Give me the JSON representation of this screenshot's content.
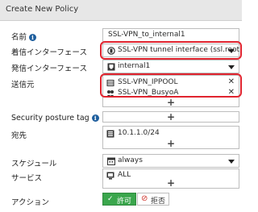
{
  "dialog": {
    "title": "Create New Policy"
  },
  "form": {
    "name": {
      "label": "名前",
      "value": "SSL-VPN_to_internal1"
    },
    "incoming_interface": {
      "label": "着信インターフェース",
      "value": "SSL-VPN tunnel interface (ssl.root)"
    },
    "outgoing_interface": {
      "label": "発信インターフェース",
      "value": "internal1"
    },
    "source": {
      "label": "送信元",
      "items": [
        "SSL-VPN_IPPOOL",
        "SSL-VPN_BusyoA"
      ]
    },
    "security_posture_tag": {
      "label": "Security posture tag"
    },
    "destination": {
      "label": "宛先",
      "items": [
        "10.1.1.0/24"
      ]
    },
    "schedule": {
      "label": "スケジュール",
      "value": "always"
    },
    "service": {
      "label": "サービス",
      "items": [
        "ALL"
      ]
    },
    "action": {
      "label": "アクション",
      "accept": "許可",
      "deny": "拒否"
    }
  },
  "icons": {
    "info": "i",
    "remove": "✕",
    "add": "+",
    "accept": "✓",
    "deny": "⊘"
  },
  "colors": {
    "highlight": "#e0242f",
    "accept_green": "#3aa64c",
    "info_blue": "#1f5f9e"
  }
}
